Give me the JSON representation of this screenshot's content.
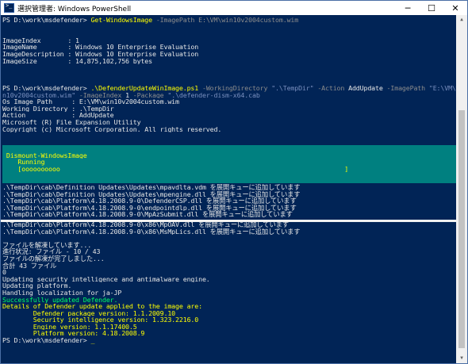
{
  "window": {
    "title": "選択管理者: Windows PowerShell",
    "minimize": "─",
    "maximize": "☐",
    "close": "✕"
  },
  "console": {
    "l1_prompt": "PS D:\\work\\msdefender> ",
    "l1_cmd": "Get-WindowsImage",
    "l1_args": " -ImagePath E:\\VM\\win10v2004custom.wim",
    "l2": "",
    "l3": "",
    "l4": "ImageIndex       : 1",
    "l5": "ImageName        : Windows 10 Enterprise Evaluation",
    "l6": "ImageDescription : Windows 10 Enterprise Evaluation",
    "l7": "ImageSize        : 14,875,102,756 bytes",
    "l8": "",
    "l9": "",
    "l10": "",
    "l11_prompt": "PS D:\\work\\msdefender> ",
    "l11_cmd": ".\\DefenderUpdateWinImage.ps1",
    "l11_a1": " -WorkingDirectory ",
    "l11_s1": "\".\\TempDir\"",
    "l11_a2": " -Action ",
    "l11_v2": "AddUpdate",
    "l11_a3": " -ImagePath ",
    "l11_s3": "\"E:\\VM\\wi",
    "l12_s": "n10v2004custom.wim\"",
    "l12_a1": " -ImageIndex ",
    "l12_v1": "1",
    "l12_a2": " -Package ",
    "l12_s2": "\".\\defender-dism-x64.cab",
    "l13": "Os Image Path     : E:\\VM\\win10v2004custom.wim",
    "l14": "Working Directory : .\\TempDir",
    "l15": "Action            : AddUpdate",
    "l16": "Microsoft (R) File Expansion Utility",
    "l17": "Copyright (c) Microsoft Corporation. All rights reserved.",
    "p1": "",
    "p2": " Dismount-WindowsImage",
    "p3": "    Running",
    "p4": "    [oooooooooo                                                                          ]",
    "p5": "",
    "e1": ".\\TempDir\\cab\\Definition Updates\\Updates\\mpavdlta.vdm を展開キューに追加しています",
    "e2": ".\\TempDir\\cab\\Definition Updates\\Updates\\mpengine.dll を展開キューに追加しています",
    "e3": ".\\TempDir\\cab\\Platform\\4.18.2008.9-0\\DefenderCSP.dll を展開キューに追加しています",
    "e4": ".\\TempDir\\cab\\Platform\\4.18.2008.9-0\\endpointdlp.dll を展開キューに追加しています",
    "e5": ".\\TempDir\\cab\\Platform\\4.18.2008.9-0\\MpAzSubmit.dll を展開キューに追加しています",
    "e6": ".\\TempDir\\cab\\Platform\\4.18.2008.9-0\\x86\\MpOAV.dll を展開キューに追加しています",
    "e7": ".\\TempDir\\cab\\Platform\\4.18.2008.9-0\\x86\\MsMpLics.dll を展開キューに追加しています",
    "f1": "",
    "f2": "ファイルを解凍しています...",
    "f3": "進行状況: ファイル - 10 / 43",
    "f4": "ファイルの解凍が完了しました...",
    "f5": "合計 43 ファイル",
    "f6": "0",
    "f7": "Updating security intelligence and antimalware engine.",
    "f8": "Updating platform.",
    "f9": "Handling localization for ja-JP",
    "f10": "Successfully updated Defender.",
    "f11": "Details of Defender update applied to the image are:",
    "f12": "        Defender package version: 1.1.2009.10",
    "f13": "        Security intelligence version: 1.323.2216.0",
    "f14": "        Engine version: 1.1.17400.5",
    "f15": "        Platform version: 4.18.2008.9",
    "f16_prompt": "PS D:\\work\\msdefender> ",
    "cursor": "_"
  },
  "colors": {
    "background": "#012456",
    "progress_bg": "#008080",
    "command": "#ffff00",
    "parameter": "#8c8c8c",
    "string": "#7a8fbf",
    "success": "#00ff66"
  }
}
